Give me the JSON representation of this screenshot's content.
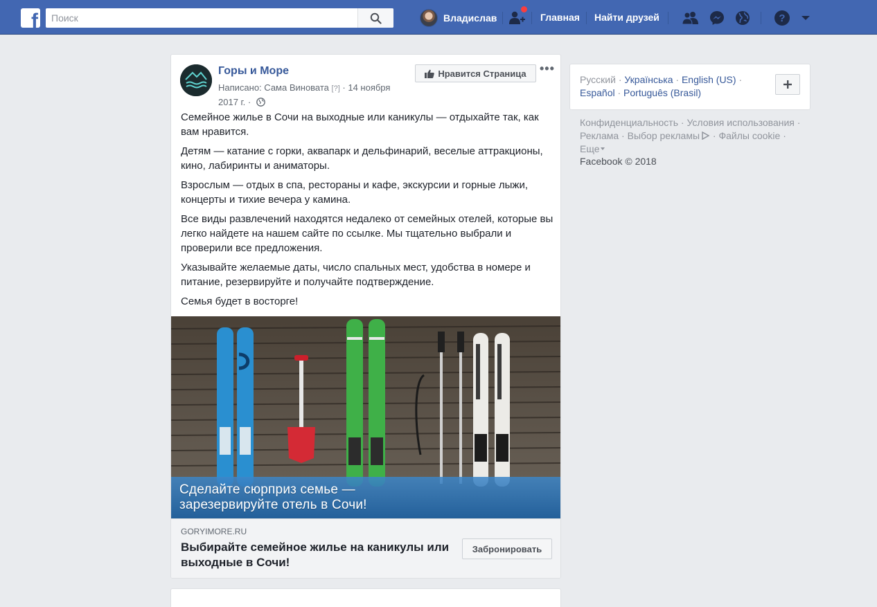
{
  "topbar": {
    "search_placeholder": "Поиск",
    "user_name": "Владислав",
    "home_label": "Главная",
    "find_friends_label": "Найти друзей"
  },
  "post": {
    "page_name": "Горы и Море",
    "meta_prefix": "Написано: Сама Виновата",
    "meta_help": "[?]",
    "meta_date": "14 ноября 2017 г.",
    "like_page_label": "Нравится Страница",
    "paragraphs": [
      "Семейное жилье в Сочи на выходные или каникулы — отдыхайте так, как вам нравится.",
      "Детям — катание с горки, аквапарк и дельфинарий, веселые аттракционы, кино, лабиринты и аниматоры.",
      "Взрослым — отдых в спа, рестораны и кафе, экскурсии и горные лыжи, концерты и тихие вечера у камина.",
      "Все виды развлечений находятся недалеко от семейных отелей, которые вы легко найдете на нашем сайте по ссылке. Мы тщательно выбрали и проверили все предложения.",
      "Указывайте желаемые даты, число спальных мест, удобства в номере и питание, резервируйте и получайте подтверждение.",
      "Семья будет в восторге!"
    ],
    "image_caption_line1": "Сделайте сюрприз семье —",
    "image_caption_line2": "зарезервируйте отель в Сочи!",
    "link_domain": "GORYIMORE.RU",
    "link_title": "Выбирайте семейное жилье на каникулы или выходные в Сочи!",
    "cta_label": "Забронировать"
  },
  "languages": {
    "current": "Русский",
    "items": [
      "Українська",
      "English (US)",
      "Español",
      "Português (Brasil)"
    ]
  },
  "footer": {
    "links": [
      "Конфиденциальность",
      "Условия использования",
      "Реклама",
      "Выбор рекламы",
      "Файлы cookie",
      "Еще"
    ],
    "copyright": "Facebook © 2018"
  },
  "colors": {
    "brand_blue": "#4267b2",
    "link_blue": "#365899",
    "page_bg": "#e9ebee",
    "notification_red": "#fa3e3e"
  },
  "icons": [
    "facebook-logo-icon",
    "search-icon",
    "friend-requests-icon",
    "friends-icon",
    "messenger-icon",
    "globe-icon",
    "help-icon",
    "caret-down-icon",
    "thumbs-up-icon",
    "more-icon",
    "plus-icon",
    "ad-choices-icon"
  ]
}
